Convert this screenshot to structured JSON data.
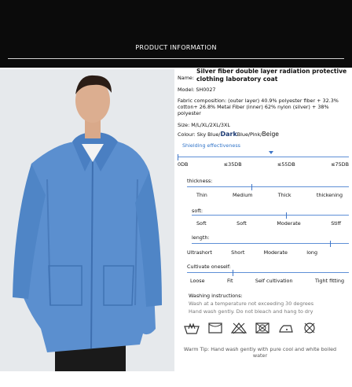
{
  "header": {
    "title": "PRODUCT INFORMATION"
  },
  "product": {
    "name_label": "Name:",
    "name": "Silver fiber double layer radiation protective clothing laboratory coat",
    "model": "Model: SH0027",
    "fabric": "Fabric composition: (outer layer) 40.9% polyester fiber + 32.3% cotton+ 26.8% Metal Fiber (inner) 62% nylon (silver) + 38% polyester",
    "size": "Size: M/L/XL/2XL/3XL",
    "colour_prefix": "Colour: Sky Blue/",
    "colour_dark": "Dark",
    "colour_rest": "Blue/Pink/",
    "colour_beige": "Beige"
  },
  "shielding": {
    "title": "Shielding effectiveness",
    "labels": [
      "0DB",
      "≤35DB",
      "≤55DB",
      "≤75DB"
    ]
  },
  "thickness": {
    "title": "thickness:",
    "labels": [
      "Thin",
      "Medium",
      "Thick",
      "thickening"
    ]
  },
  "soft": {
    "title": "soft:",
    "labels": [
      "Soft",
      "Soft",
      "Moderate",
      "Stiff"
    ]
  },
  "length": {
    "title": "length:",
    "labels": [
      "Ultrashort",
      "Short",
      "Moderate",
      "long"
    ]
  },
  "cultivate": {
    "title": "Cultivate oneself:",
    "labels": [
      "Loose",
      "Fit",
      "Self cultivation",
      "Tight fitting"
    ]
  },
  "washing": {
    "title": "Washing instructions:",
    "line1": "Wash at a temperature not exceeding 30 degrees",
    "line2": "Hand wash gently. Do not bleach and hang to dry"
  },
  "icons": [
    "hand-wash-icon",
    "hang-dry-icon",
    "no-bleach-icon",
    "no-tumble-dry-icon",
    "low-iron-icon",
    "dry-clean-icon"
  ],
  "tip": "Warm Tip: Hand wash gently with pure cool and white boiled water",
  "colors": {
    "accent": "#3f76c7",
    "coat": "#5b8fcf",
    "header": "#0b0b0b"
  }
}
